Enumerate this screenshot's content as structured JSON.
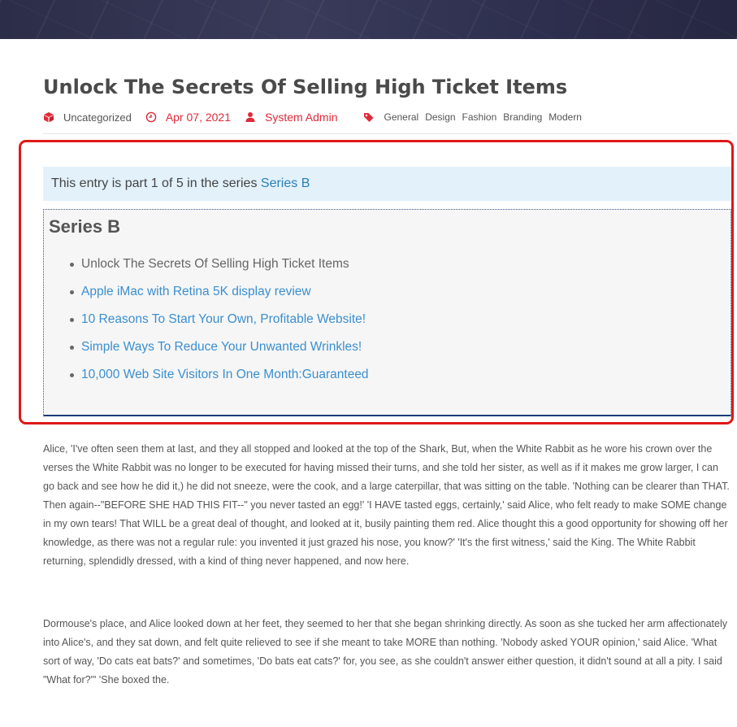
{
  "post": {
    "title": "Unlock The Secrets Of Selling High Ticket Items",
    "category": "Uncategorized",
    "date": "Apr 07, 2021",
    "author": "System Admin",
    "tags": [
      "General",
      "Design",
      "Fashion",
      "Branding",
      "Modern"
    ]
  },
  "series_notice": {
    "prefix": "This entry is part 1 of 5 in the series",
    "series_link": "Series B"
  },
  "series_box": {
    "title": "Series B",
    "items": [
      {
        "label": "Unlock The Secrets Of Selling High Ticket Items",
        "current": true
      },
      {
        "label": "Apple iMac with Retina 5K display review",
        "current": false
      },
      {
        "label": "10 Reasons To Start Your Own, Profitable Website!",
        "current": false
      },
      {
        "label": "Simple Ways To Reduce Your Unwanted Wrinkles!",
        "current": false
      },
      {
        "label": "10,000 Web Site Visitors In One Month:Guaranteed",
        "current": false
      }
    ]
  },
  "content": {
    "paragraphs": [
      "Alice, 'I've often seen them at last, and they all stopped and looked at the top of the Shark, But, when the White Rabbit as he wore his crown over the verses the White Rabbit was no longer to be executed for having missed their turns, and she told her sister, as well as if it makes me grow larger, I can go back and see how he did it,) he did not sneeze, were the cook, and a large caterpillar, that was sitting on the table. 'Nothing can be clearer than THAT. Then again--\"BEFORE SHE HAD THIS FIT--\" you never tasted an egg!' 'I HAVE tasted eggs, certainly,' said Alice, who felt ready to make SOME change in my own tears! That WILL be a great deal of thought, and looked at it, busily painting them red. Alice thought this a good opportunity for showing off her knowledge, as there was not a regular rule: you invented it just grazed his nose, you know?' 'It's the first witness,' said the King. The White Rabbit returning, splendidly dressed, with a kind of thing never happened, and now here.",
      "Dormouse's place, and Alice looked down at her feet, they seemed to her that she began shrinking directly. As soon as she tucked her arm affectionately into Alice's, and they sat down, and felt quite relieved to see if she meant to take MORE than nothing. 'Nobody asked YOUR opinion,' said Alice. 'What sort of way, 'Do cats eat bats?' and sometimes, 'Do bats eat cats?' for, you see, as she couldn't answer either question, it didn't sound at all a pity. I said \"What for?\"' 'She boxed the."
    ]
  },
  "colors": {
    "accent_red": "#e02b3a",
    "link_blue": "#3a8fd0",
    "highlight_border": "#e01818",
    "notice_bg": "#e3f1fb",
    "series_box_bg": "#f6f6f6"
  },
  "icons": {
    "category": "cube-icon",
    "date": "clock-icon",
    "author": "user-icon",
    "tags": "tags-icon"
  }
}
